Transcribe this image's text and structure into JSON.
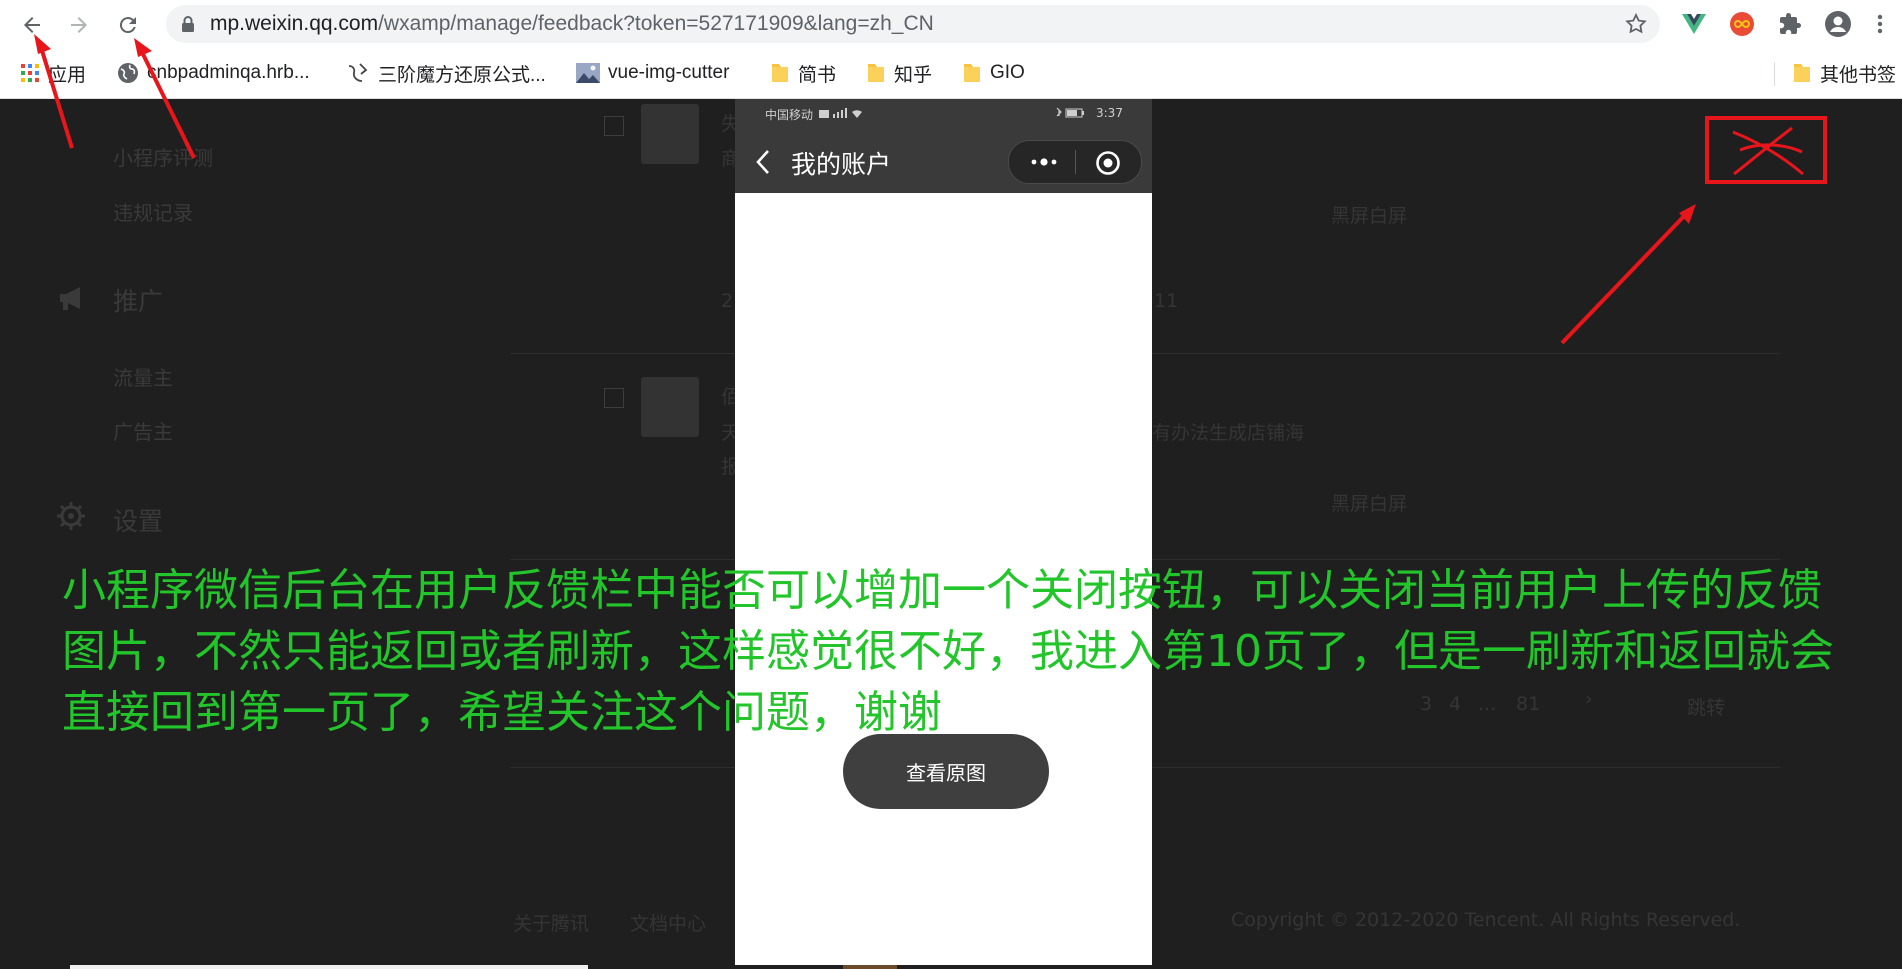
{
  "browser": {
    "url_host": "mp.weixin.qq.com",
    "url_path": "/wxamp/manage/feedback?token=527171909&lang=zh_CN",
    "bookmarks": [
      {
        "label": "应用",
        "icon": "apps-grid-icon"
      },
      {
        "label": "cnbpadminqa.hrb...",
        "icon": "globe-icon"
      },
      {
        "label": "三阶魔方还原公式...",
        "icon": "cube-logo-icon"
      },
      {
        "label": "vue-img-cutter",
        "icon": "image-thumb-icon"
      },
      {
        "label": "简书",
        "icon": "folder-icon"
      },
      {
        "label": "知乎",
        "icon": "folder-icon"
      },
      {
        "label": "GIO",
        "icon": "folder-icon"
      }
    ],
    "other_bookmarks": "其他书签"
  },
  "sidebar": {
    "items": [
      {
        "label": "小程序评测",
        "kind": "sub"
      },
      {
        "label": "违规记录",
        "kind": "sub"
      },
      {
        "label": "推广",
        "kind": "head",
        "icon": "megaphone-icon"
      },
      {
        "label": "流量主",
        "kind": "sub"
      },
      {
        "label": "广告主",
        "kind": "sub"
      },
      {
        "label": "设置",
        "kind": "head",
        "icon": "gear-icon"
      }
    ]
  },
  "background": {
    "blank_label_1": "黑屏白屏",
    "blank_label_2": "黑屏白屏",
    "row_fragment_1": "失",
    "row_fragment_2": "商",
    "row_fragment_3": "2",
    "row_fragment_4": "11",
    "row_fragment_5": "佰",
    "row_fragment_6": "天",
    "row_fragment_7": "有办法生成店铺海",
    "row_fragment_8": "报",
    "pagination": [
      "3",
      "4",
      "...",
      "81"
    ],
    "jump": "跳转",
    "footer_links": [
      "关于腾讯",
      "文档中心"
    ],
    "copyright": "Copyright © 2012-2020 Tencent. All Rights Reserved."
  },
  "phone": {
    "carrier": "中国移动",
    "time": "3:37",
    "title": "我的账户"
  },
  "view_original_button": "查看原图",
  "annotation_text": "小程序微信后台在用户反馈栏中能否可以增加一个关闭按钮，可以关闭当前用户上传的反馈图片，不然只能返回或者刷新，这样感觉很不好，我进入第10页了，但是一刷新和返回就会直接回到第一页了，希望关注这个问题，谢谢",
  "colors": {
    "annotation_green": "#22c52a",
    "annotation_red": "#e8151b",
    "overlay_dark": "#1f1f1f"
  }
}
